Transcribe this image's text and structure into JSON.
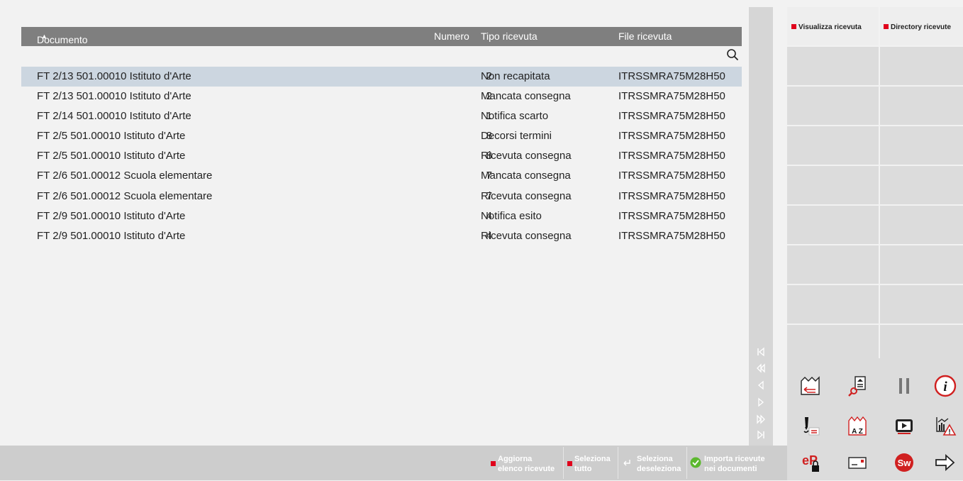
{
  "table": {
    "headers": {
      "documento": "Documento",
      "numero": "Numero",
      "tipo": "Tipo ricevuta",
      "file": "File ricevuta"
    },
    "sort_indicator": "▲",
    "rows": [
      {
        "documento": "FT 2/13 501.00010 Istituto d'Arte",
        "numero": "2",
        "tipo": "Non recapitata",
        "file": "ITRSSMRA75M28H50"
      },
      {
        "documento": "FT 2/13 501.00010 Istituto d'Arte",
        "numero": "2",
        "tipo": "Mancata consegna",
        "file": "ITRSSMRA75M28H50"
      },
      {
        "documento": "FT 2/14 501.00010 Istituto d'Arte",
        "numero": "1",
        "tipo": "Notifica scarto",
        "file": "ITRSSMRA75M28H50"
      },
      {
        "documento": "FT 2/5 501.00010  Istituto d'Arte",
        "numero": "8",
        "tipo": "Decorsi termini",
        "file": "ITRSSMRA75M28H50"
      },
      {
        "documento": "FT 2/5 501.00010  Istituto d'Arte",
        "numero": "8",
        "tipo": "Ricevuta consegna",
        "file": "ITRSSMRA75M28H50"
      },
      {
        "documento": "FT 2/6 501.00012 Scuola elementare",
        "numero": "7",
        "tipo": "Mancata consegna",
        "file": "ITRSSMRA75M28H50"
      },
      {
        "documento": "FT 2/6 501.00012 Scuola elementare",
        "numero": "7",
        "tipo": "Ricevuta consegna",
        "file": "ITRSSMRA75M28H50"
      },
      {
        "documento": "FT 2/9 501.00010 Istituto d'Arte",
        "numero": "4",
        "tipo": "Notifica esito",
        "file": "ITRSSMRA75M28H50"
      },
      {
        "documento": "FT 2/9 501.00010 Istituto d'Arte",
        "numero": "4",
        "tipo": "Ricevuta consegna",
        "file": "ITRSSMRA75M28H50"
      }
    ],
    "selected_row": 0
  },
  "right_panel": {
    "visualizza": "Visualizza ricevuta",
    "directory": "Directory ricevute"
  },
  "bottom_bar": {
    "aggiorna_1": "Aggiorna",
    "aggiorna_2": "elenco ricevute",
    "seleziona_tutto_1": "Seleziona",
    "seleziona_tutto_2": "tutto",
    "seleziona_desel_1": "Seleziona",
    "seleziona_desel_2": "deseleziona",
    "importa_1": "Importa ricevute",
    "importa_2": "nei documenti"
  },
  "icons": {
    "nav": [
      "first-page-icon",
      "prev-page-icon",
      "prev-icon",
      "next-icon",
      "next-page-icon",
      "last-page-icon"
    ],
    "toolbar": [
      "export-icon",
      "search-document-icon",
      "pause-icon",
      "info-icon",
      "signature-icon",
      "sort-az-icon",
      "video-icon",
      "chart-warning-icon",
      "epa-lock-icon",
      "envelope-icon",
      "sw-logo-icon",
      "arrow-right-icon"
    ]
  },
  "colors": {
    "header_bg": "#7f7f7f",
    "selected_row": "#ccd6e0",
    "accent_red": "#e0001b",
    "check_green": "#5cb82e"
  }
}
